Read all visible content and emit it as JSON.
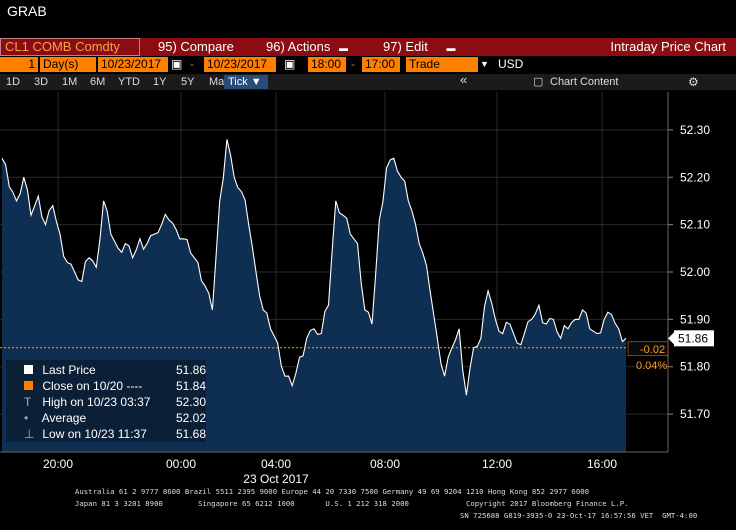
{
  "window": {
    "title": "GRAB"
  },
  "menubar": {
    "ticker": "CL1 COMB Comdty",
    "compare": "95) Compare",
    "actions": "96) Actions",
    "edit": "97) Edit",
    "chart_title": "Intraday Price Chart"
  },
  "controls": {
    "days": "1",
    "days_label": "Day(s)",
    "start_date": "10/23/2017",
    "end_date": "10/23/2017",
    "start_time": "18:00",
    "end_time": "17:00",
    "mode": "Trade",
    "currency": "USD"
  },
  "toolbar": {
    "ranges": [
      "1D",
      "3D",
      "1M",
      "6M",
      "YTD",
      "1Y",
      "5Y",
      "Max"
    ],
    "active": "Tick ▼",
    "collapse": "«",
    "chart_content": "Chart Content",
    "settings": "⚙"
  },
  "chart_data": {
    "type": "area",
    "ylim": [
      51.62,
      52.38
    ],
    "y_ticks": [
      "52.30",
      "52.20",
      "52.10",
      "52.00",
      "51.90",
      "51.80",
      "51.70"
    ],
    "x_ticks": [
      "20:00",
      "00:00",
      "04:00",
      "08:00",
      "12:00",
      "16:00"
    ],
    "x_date_label": "23 Oct 2017",
    "reference_close": 51.84,
    "last_price_label": "51.86",
    "change": "-0.02",
    "change_pct": "0.04%",
    "series": [
      {
        "values": [
          52.24,
          52.18,
          52.15,
          52.2,
          52.12,
          52.16,
          52.1,
          52.14,
          52.08,
          52.02,
          52.0,
          51.98,
          52.03,
          52.01,
          52.15,
          52.08,
          52.05,
          52.06,
          52.03,
          52.07,
          52.06,
          52.08,
          52.1,
          52.11,
          52.09,
          52.07,
          52.04,
          52.02,
          51.97,
          51.92,
          52.15,
          52.28,
          52.2,
          52.17,
          52.1,
          52.0,
          51.92,
          51.88,
          51.85,
          51.78,
          51.76,
          51.82,
          51.86,
          51.88,
          51.87,
          51.93,
          52.15,
          52.12,
          52.08,
          52.06,
          51.92,
          51.89,
          52.11,
          52.22,
          52.24,
          52.2,
          52.15,
          52.1,
          52.04,
          51.96,
          51.86,
          51.78,
          51.84,
          51.88,
          51.74,
          51.84,
          51.86,
          51.96,
          51.9,
          51.87,
          51.89,
          51.85,
          51.87,
          51.9,
          51.93,
          51.89,
          51.9,
          51.86,
          51.88,
          51.9,
          51.92,
          51.88,
          51.87,
          51.9,
          51.91,
          51.88,
          51.86
        ]
      }
    ],
    "legend": [
      {
        "label": "Last Price",
        "value": "51.86"
      },
      {
        "label": "Close on 10/20 ----",
        "value": "51.84"
      },
      {
        "label": "High on 10/23 03:37",
        "value": "52.30"
      },
      {
        "label": "Average",
        "value": "52.02"
      },
      {
        "label": "Low on 10/23 11:37",
        "value": "51.68"
      }
    ]
  },
  "footer": {
    "line1": "Australia 61 2 9777 8600 Brazil 5511 2395 9000 Europe 44 20 7330 7500 Germany 49 69 9204 1210 Hong Kong 852 2977 6000",
    "line2": "Japan 81 3 3201 8900        Singapore 65 6212 1000       U.S. 1 212 318 2000             Copyright 2017 Bloomberg Finance L.P.",
    "line3": "SN 725688 G819-3935-0 23-Oct-17 16:57:56 VET  GMT-4:00"
  },
  "colors": {
    "menubar": "#8b0d12",
    "orange": "#ff7f00",
    "area_fill": "#0e2f52",
    "area_line": "#ffffff"
  }
}
